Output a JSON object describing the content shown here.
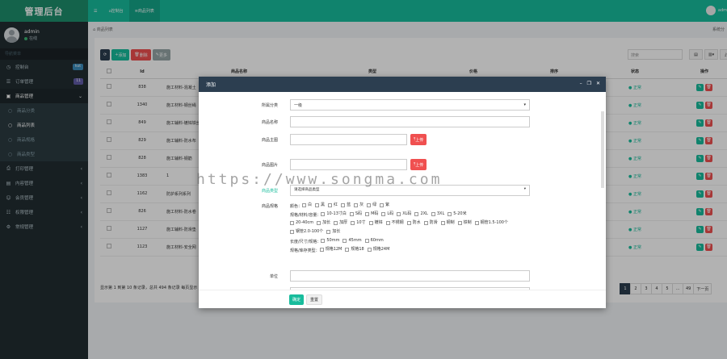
{
  "app": {
    "title": "管理后台"
  },
  "user": {
    "name": "admin",
    "status": "在线"
  },
  "nav": {
    "header": "导航菜单",
    "items": [
      {
        "label": "控制台",
        "icon": "dashboard-icon",
        "badge": "hot",
        "badge_color": "#3c8dbc"
      },
      {
        "label": "订单管理",
        "icon": "list-icon",
        "badge": "11",
        "badge_color": "#605ca8"
      },
      {
        "label": "商品管理",
        "icon": "gift-icon",
        "open": true
      },
      {
        "label": "商品分类",
        "icon": "dot-icon",
        "sub": true
      },
      {
        "label": "商品列表",
        "icon": "dot-icon",
        "sub": true,
        "current": true
      },
      {
        "label": "商品规格",
        "icon": "dot-icon",
        "sub": true
      },
      {
        "label": "商品类型",
        "icon": "dot-icon",
        "sub": true
      },
      {
        "label": "打印管理",
        "icon": "print-icon"
      },
      {
        "label": "内容管理",
        "icon": "file-icon"
      },
      {
        "label": "会员管理",
        "icon": "user-icon"
      },
      {
        "label": "权限管理",
        "icon": "group-icon"
      },
      {
        "label": "常规管理",
        "icon": "cog-icon"
      }
    ]
  },
  "topbar": {
    "tabs": [
      "控制台",
      "商品列表"
    ],
    "user": "adm"
  },
  "crumb": {
    "left": "商品列表",
    "right": "系统分"
  },
  "toolbar": {
    "add": "添加",
    "delete": "删除",
    "more": "更多",
    "search_placeholder": "搜索"
  },
  "table": {
    "headers": [
      "",
      "Id",
      "商品名称",
      "类型",
      "价格",
      "排序",
      "状态",
      "操作"
    ],
    "rows": [
      {
        "id": "838",
        "name": "施工材料-混凝土"
      },
      {
        "id": "1340",
        "name": "施工材料-钢丝绳"
      },
      {
        "id": "849",
        "name": "施工辅料-镀锌铁丝"
      },
      {
        "id": "829",
        "name": "施工辅料-防水布"
      },
      {
        "id": "828",
        "name": "施工辅料-钢筋"
      },
      {
        "id": "1383",
        "name": "1"
      },
      {
        "id": "1162",
        "name": "防护系列系列"
      },
      {
        "id": "826",
        "name": "施工材料-防水卷"
      },
      {
        "id": "1127",
        "name": "施工辅料-防滑垫"
      },
      {
        "id": "1123",
        "name": "施工材料-安全网"
      }
    ],
    "status_label": "正常"
  },
  "pagination": {
    "summary": "显示第 1 到第 10 条记录，总共 494 条记录 每页显示",
    "pages": [
      "1",
      "2",
      "3",
      "4",
      "5",
      "...",
      "49",
      "下一页"
    ]
  },
  "modal": {
    "title": "添加",
    "fields": {
      "category": {
        "label": "所属分类",
        "value": "一级"
      },
      "name": {
        "label": "商品名称"
      },
      "image": {
        "label": "商品主图",
        "button": "上传"
      },
      "images": {
        "label": "商品图片",
        "button": "上传"
      },
      "type": {
        "label": "商品类型",
        "value": "请选择商品类型"
      },
      "spec": {
        "label": "商品规格",
        "line1_prefix": "颜色：",
        "colors": [
          "白",
          "黑",
          "红",
          "蓝",
          "灰",
          "绿",
          "紫"
        ],
        "line2_prefix": "规格/材料/容量：",
        "sizes": [
          "10-13寸白",
          "S码",
          "M码",
          "L码",
          "XL码",
          "2XL",
          "3XL",
          "5-20米"
        ],
        "extra": [
          "20-40cm",
          "加长",
          "加厚",
          "10寸",
          "镀锌",
          "不锈钢",
          "防水",
          "防滑",
          "钢制",
          "铁制",
          "钢管1.5-100个",
          "钢管2.0-100个",
          "加长"
        ],
        "line4_prefix": "长度/尺寸/规格：",
        "lengths": [
          "50mm",
          "45mm",
          "60mm"
        ],
        "line5_prefix": "规格/库存类型：",
        "stocks": [
          "规格12M",
          "规格18",
          "规格24M"
        ]
      },
      "unit": {
        "label": "单位"
      }
    },
    "ok": "确定",
    "reset": "重置"
  },
  "watermark": "https://www.songma.com"
}
